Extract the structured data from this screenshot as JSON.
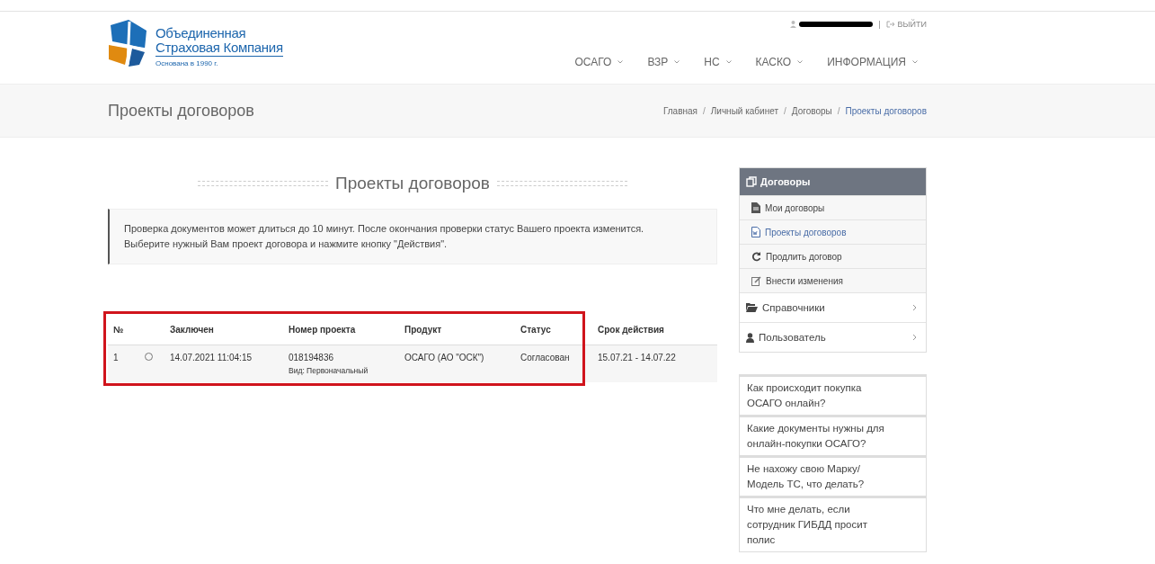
{
  "logo": {
    "line1": "Объединенная",
    "line2": "Страховая Компания",
    "tagline": "Основана в 1990 г."
  },
  "user_bar": {
    "separator": "|",
    "logout": "ВЫЙТИ"
  },
  "nav": [
    {
      "label": "ОСАГО"
    },
    {
      "label": "ВЗР"
    },
    {
      "label": "НС"
    },
    {
      "label": "КАСКО"
    },
    {
      "label": "ИНФОРМАЦИЯ"
    }
  ],
  "page_title": "Проекты договоров",
  "breadcrumbs": [
    {
      "label": "Главная",
      "current": false,
      "separator": "/"
    },
    {
      "label": "Личный кабинет",
      "current": false,
      "separator": "/"
    },
    {
      "label": "Договоры",
      "current": false,
      "separator": "/"
    },
    {
      "label": "Проекты договоров",
      "current": true
    }
  ],
  "section_title": "Проекты договоров",
  "notice": [
    "Проверка документов может длиться до 10 минут. После окончания проверки статус Вашего проекта изменится.",
    "Выберите нужный Вам проект договора и нажмите кнопку \"Действия\"."
  ],
  "table": {
    "columns": [
      "№",
      "Заключен",
      "Номер проекта",
      "Продукт",
      "Статус",
      "Срок действия"
    ],
    "rows": [
      {
        "num": "1",
        "selected": false,
        "date": "14.07.2021 11:04:15",
        "project": "018194836",
        "project_kind": "Вид: Первоначальный",
        "product": "ОСАГО (АО \"ОСК\")",
        "status": "Согласован",
        "term": "15.07.21 - 14.07.22"
      }
    ]
  },
  "sidebar": {
    "header": "Договоры",
    "items": [
      {
        "kind": "sub",
        "label": "Мои договоры",
        "selected": false
      },
      {
        "kind": "sub",
        "label": "Проекты договоров",
        "selected": true
      },
      {
        "kind": "sub",
        "label": "Продлить договор",
        "selected": false
      },
      {
        "kind": "sub",
        "label": "Внести изменения",
        "selected": false
      },
      {
        "kind": "group",
        "label": "Справочники",
        "selected": false
      },
      {
        "kind": "group",
        "label": "Пользователь",
        "selected": false
      }
    ]
  },
  "faq": [
    "Как происходит покупка ОСАГО онлайн?",
    "Какие документы нужны для онлайн-покупки ОСАГО?",
    "Не нахожу свою Марку/Модель ТС, что делать?",
    "Что мне делать, если сотрудник ГИБДД просит полис"
  ]
}
